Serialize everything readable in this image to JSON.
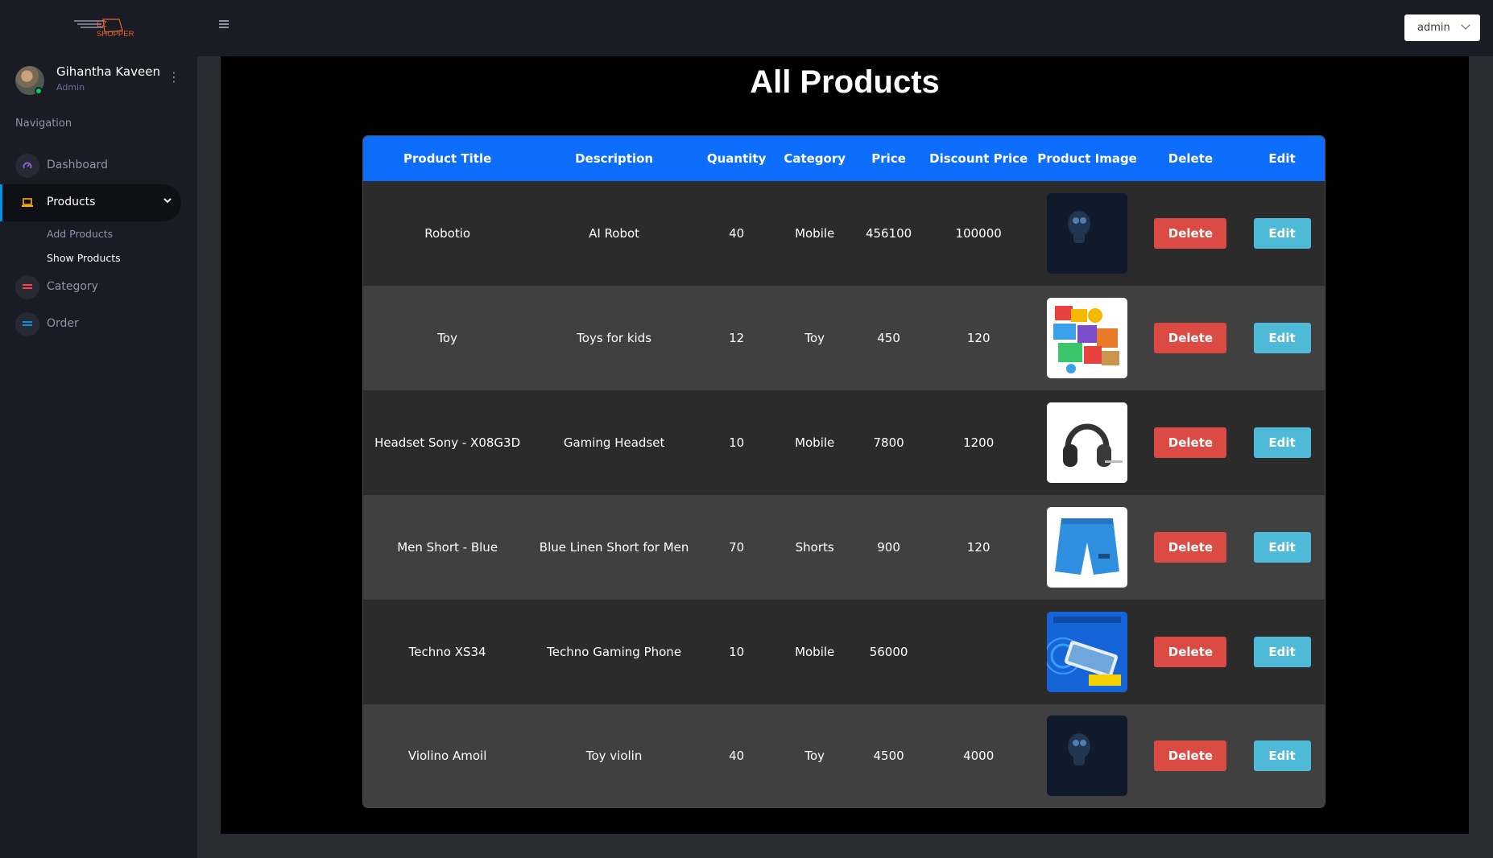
{
  "brand": {
    "logo_text": "EZ SHOPPER"
  },
  "profile": {
    "name": "Gihantha Kaveen",
    "role": "Admin",
    "menu_icon": "vertical-dots-icon"
  },
  "sidebar": {
    "heading": "Navigation",
    "items": [
      {
        "label": "Dashboard",
        "icon": "speedometer-icon",
        "icon_color": "#8f5fe8"
      },
      {
        "label": "Products",
        "icon": "laptop-icon",
        "icon_color": "#ffab00",
        "active": true,
        "subitems": [
          {
            "label": "Add Products"
          },
          {
            "label": "Show Products"
          }
        ]
      },
      {
        "label": "Category",
        "icon": "list-icon",
        "icon_color": "#fc424a"
      },
      {
        "label": "Order",
        "icon": "list-icon",
        "icon_color": "#0090e7"
      }
    ]
  },
  "topbar": {
    "menu_icon": "hamburger-icon",
    "user_dropdown": "admin"
  },
  "main": {
    "title": "All Products",
    "table": {
      "columns": [
        "Product Title",
        "Description",
        "Quantity",
        "Category",
        "Price",
        "Discount Price",
        "Product Image",
        "Delete",
        "Edit"
      ],
      "rows": [
        {
          "title": "Robotio",
          "description": "AI Robot",
          "quantity": "40",
          "category": "Mobile",
          "price": "456100",
          "discount": "100000",
          "image": "robot-image"
        },
        {
          "title": "Toy",
          "description": "Toys for kids",
          "quantity": "12",
          "category": "Toy",
          "price": "450",
          "discount": "120",
          "image": "toy-shop-image"
        },
        {
          "title": "Headset Sony - X08G3D",
          "description": "Gaming Headset",
          "quantity": "10",
          "category": "Mobile",
          "price": "7800",
          "discount": "1200",
          "image": "headset-image"
        },
        {
          "title": "Men Short - Blue",
          "description": "Blue Linen Short for Men",
          "quantity": "70",
          "category": "Shorts",
          "price": "900",
          "discount": "120",
          "image": "blue-shorts-image"
        },
        {
          "title": "Techno XS34",
          "description": "Techno Gaming Phone",
          "quantity": "10",
          "category": "Mobile",
          "price": "56000",
          "discount": "",
          "image": "phone-image"
        },
        {
          "title": "Violino Amoil",
          "description": "Toy violin",
          "quantity": "40",
          "category": "Toy",
          "price": "4500",
          "discount": "4000",
          "image": "robot-image"
        }
      ],
      "delete_label": "Delete",
      "edit_label": "Edit"
    }
  },
  "colors": {
    "table_header": "#0d6efd",
    "delete_button": "#dc4a44",
    "edit_button": "#4fb9d8",
    "logo_accent": "#e8632b"
  }
}
